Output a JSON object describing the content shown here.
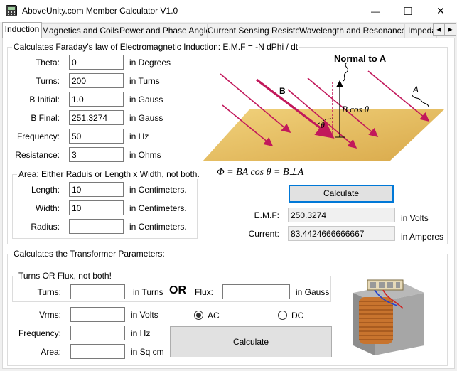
{
  "window": {
    "title": "AboveUnity.com Member Calculator V1.0",
    "minimize_glyph": "—",
    "maximize_glyph": "☐",
    "close_glyph": "✕"
  },
  "tabs": [
    {
      "label": "Induction",
      "active": true
    },
    {
      "label": "Magnetics and Coils",
      "active": false
    },
    {
      "label": "Power and Phase Angle",
      "active": false
    },
    {
      "label": "Current Sensing Resistor",
      "active": false
    },
    {
      "label": "Wavelength and Resonance",
      "active": false
    },
    {
      "label": "Impeda",
      "active": false
    }
  ],
  "tab_scroll": {
    "left": "◀",
    "right": "▶"
  },
  "faraday": {
    "group_title": "Calculates Faraday's law of Electromagnetic Induction: E.M.F = -N dPhi / dt",
    "fields": [
      {
        "label": "Theta:",
        "value": "0",
        "unit": "in Degrees"
      },
      {
        "label": "Turns:",
        "value": "200",
        "unit": "in Turns"
      },
      {
        "label": "B Initial:",
        "value": "1.0",
        "unit": "in Gauss"
      },
      {
        "label": "B Final:",
        "value": "251.3274",
        "unit": "in Gauss"
      },
      {
        "label": "Frequency:",
        "value": "50",
        "unit": "in Hz"
      },
      {
        "label": "Resistance:",
        "value": "3",
        "unit": "in Ohms"
      }
    ],
    "area_group_title": "Area: Either Raduis or Length x Width, not both.",
    "area_fields": [
      {
        "label": "Length:",
        "value": "10",
        "unit": "in Centimeters."
      },
      {
        "label": "Width:",
        "value": "10",
        "unit": "in Centimeters."
      },
      {
        "label": "Radius:",
        "value": "",
        "unit": "in Centimeters."
      }
    ],
    "diagram": {
      "normal_label": "Normal to A",
      "b_label": "B",
      "a_label": "A",
      "bcos_label": "B  cos θ",
      "theta_label": "θ",
      "formula": "Φ = BA cos θ = B⊥A"
    },
    "calculate_label": "Calculate",
    "emf": {
      "label": "E.M.F:",
      "value": "250.3274",
      "unit": "in Volts"
    },
    "current": {
      "label": "Current:",
      "value": "83.4424666666667",
      "unit": "in Amperes"
    }
  },
  "transformer": {
    "group_title": "Calculates the Transformer Parameters:",
    "turns_flux_group_title": "Turns OR Flux, not both!",
    "turns": {
      "label": "Turns:",
      "value": "",
      "unit": "in Turns"
    },
    "or_label": "OR",
    "flux": {
      "label": "Flux:",
      "value": "",
      "unit": "in Gauss"
    },
    "vrms": {
      "label": "Vrms:",
      "value": "",
      "unit": "in Volts"
    },
    "frequency": {
      "label": "Frequency:",
      "value": "",
      "unit": "in Hz"
    },
    "area": {
      "label": "Area:",
      "value": "",
      "unit": "in Sq cm"
    },
    "ac_label": "AC",
    "dc_label": "DC",
    "selected_mode": "AC",
    "calculate_label": "Calculate"
  },
  "colors": {
    "accent": "#0078d7",
    "plane": "#e8c36a",
    "arrow": "#c2185b"
  }
}
